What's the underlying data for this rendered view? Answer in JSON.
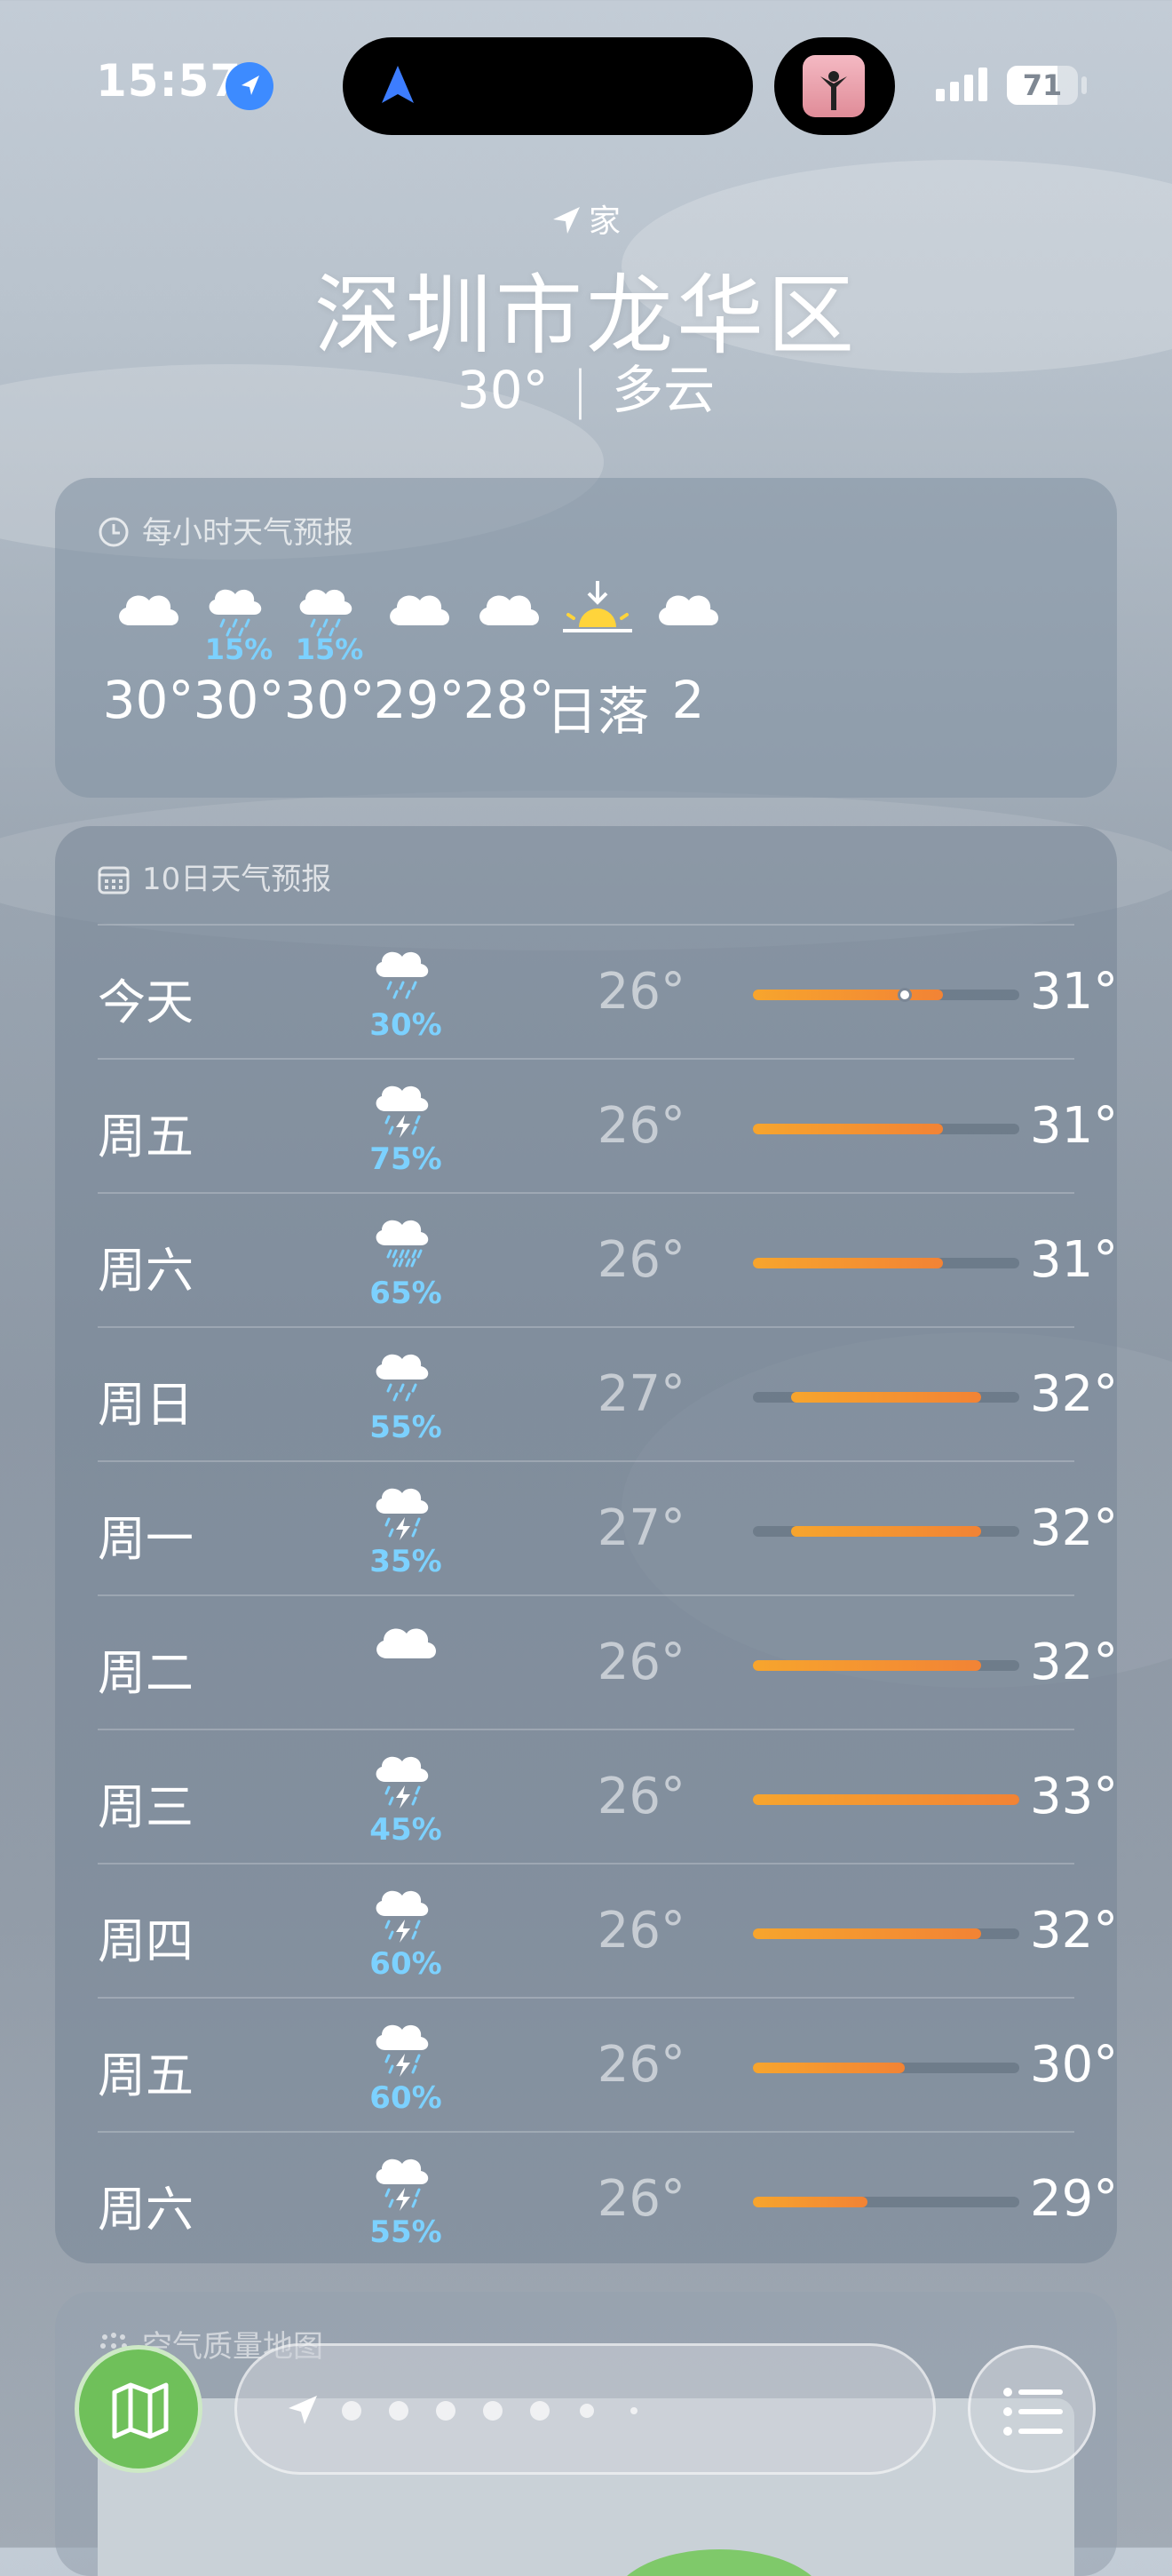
{
  "status": {
    "time": "15:57",
    "battery": "71",
    "battery_level": 0.71
  },
  "header": {
    "home_label": "家",
    "city": "深圳市龙华区",
    "current_temp": "30°",
    "separator": "|",
    "condition": "多云"
  },
  "hourly": {
    "title": "每小时天气预报",
    "items": [
      {
        "icon": "cloud-icon",
        "pct": "",
        "temp": "30°"
      },
      {
        "icon": "cloud-rain-icon",
        "pct": "15%",
        "temp": "30°"
      },
      {
        "icon": "cloud-rain-icon",
        "pct": "15%",
        "temp": "30°"
      },
      {
        "icon": "cloud-icon",
        "pct": "",
        "temp": "29°"
      },
      {
        "icon": "cloud-icon",
        "pct": "",
        "temp": "28°"
      },
      {
        "icon": "sunset-icon",
        "pct": "",
        "temp": "日落"
      },
      {
        "icon": "cloud-icon",
        "pct": "",
        "temp": "2"
      }
    ]
  },
  "daily": {
    "title": "10日天气预报",
    "range_min": 26,
    "range_max": 33,
    "days": [
      {
        "name": "今天",
        "icon": "cloud-rain-icon",
        "pct": "30%",
        "low": "26°",
        "high": "31°",
        "lo": 26,
        "hi": 31,
        "now": 30
      },
      {
        "name": "周五",
        "icon": "cloud-bolt-rain-icon",
        "pct": "75%",
        "low": "26°",
        "high": "31°",
        "lo": 26,
        "hi": 31
      },
      {
        "name": "周六",
        "icon": "cloud-heavy-rain-icon",
        "pct": "65%",
        "low": "26°",
        "high": "31°",
        "lo": 26,
        "hi": 31
      },
      {
        "name": "周日",
        "icon": "cloud-rain-icon",
        "pct": "55%",
        "low": "27°",
        "high": "32°",
        "lo": 27,
        "hi": 32
      },
      {
        "name": "周一",
        "icon": "cloud-bolt-rain-icon",
        "pct": "35%",
        "low": "27°",
        "high": "32°",
        "lo": 27,
        "hi": 32
      },
      {
        "name": "周二",
        "icon": "cloud-icon",
        "pct": "",
        "low": "26°",
        "high": "32°",
        "lo": 26,
        "hi": 32
      },
      {
        "name": "周三",
        "icon": "cloud-bolt-rain-icon",
        "pct": "45%",
        "low": "26°",
        "high": "33°",
        "lo": 26,
        "hi": 33
      },
      {
        "name": "周四",
        "icon": "cloud-bolt-rain-icon",
        "pct": "60%",
        "low": "26°",
        "high": "32°",
        "lo": 26,
        "hi": 32
      },
      {
        "name": "周五",
        "icon": "cloud-bolt-rain-icon",
        "pct": "60%",
        "low": "26°",
        "high": "30°",
        "lo": 26,
        "hi": 30
      },
      {
        "name": "周六",
        "icon": "cloud-bolt-rain-icon",
        "pct": "55%",
        "low": "26°",
        "high": "29°",
        "lo": 26,
        "hi": 29
      }
    ]
  },
  "air_quality": {
    "title": "空气质量地图"
  },
  "bottom_bar": {
    "map_icon": "map-icon",
    "list_icon": "list-icon",
    "page_count": 7,
    "current_page": 0
  },
  "colors": {
    "accent_orange": "#f28335",
    "precip_blue": "#7cd1ff",
    "map_green": "#6fc05a"
  }
}
